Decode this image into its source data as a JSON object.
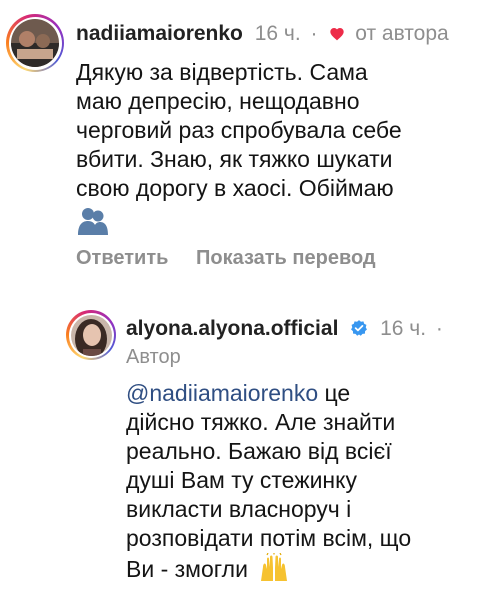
{
  "comment1": {
    "username": "nadiiamaiorenko",
    "time": "16 ч.",
    "separator": "·",
    "liked_by_author": "от автора",
    "avatar_icon": "user-avatar-icon",
    "text_lines": [
      "Дякую за відвертість. Сама",
      "маю депресію, нещодавно",
      "черговий раз спробувала себе",
      "вбити. Знаю, як тяжко шукати",
      "свою дорогу в хаосі. Обіймаю"
    ],
    "emoji_icon": "people-hugging-emoji",
    "actions": {
      "reply": "Ответить",
      "translate": "Показать перевод"
    }
  },
  "comment2": {
    "username": "alyona.alyona.official",
    "verified_icon": "verified-badge-icon",
    "time": "16 ч.",
    "separator": "·",
    "author_label": "Автор",
    "mention": "@nadiiamaiorenko",
    "text_lines": [
      " це",
      "дійсно тяжко. Але знайти",
      "реально. Бажаю від всієї",
      "душі Вам ту стежинку",
      "викласти власноруч і",
      "розповідати потім всім, що",
      "Ви - змогли"
    ],
    "emoji_icon": "raising-hands-emoji"
  },
  "colors": {
    "username": "#222222",
    "secondary": "#8e8e8e",
    "mention": "#2f4e82",
    "heart": "#ed2b48",
    "verified": "#3897f0"
  }
}
